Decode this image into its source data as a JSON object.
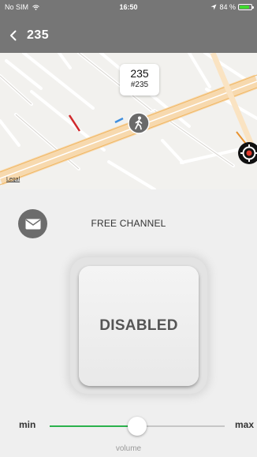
{
  "status_bar": {
    "carrier": "No SIM",
    "time": "16:50",
    "battery": "84 %",
    "battery_level": 0.84
  },
  "nav": {
    "title": "235"
  },
  "map": {
    "marker_title": "235",
    "marker_subtitle": "#235",
    "legal": "Legal"
  },
  "channel": {
    "label": "FREE CHANNEL"
  },
  "ptt": {
    "label": "DISABLED"
  },
  "volume": {
    "min": "min",
    "max": "max",
    "label": "volume",
    "value": 0.5
  },
  "colors": {
    "bar": "#767676",
    "slider": "#2bb24c",
    "battery": "#3fdc2f",
    "locate_dot": "#e23b2e"
  }
}
